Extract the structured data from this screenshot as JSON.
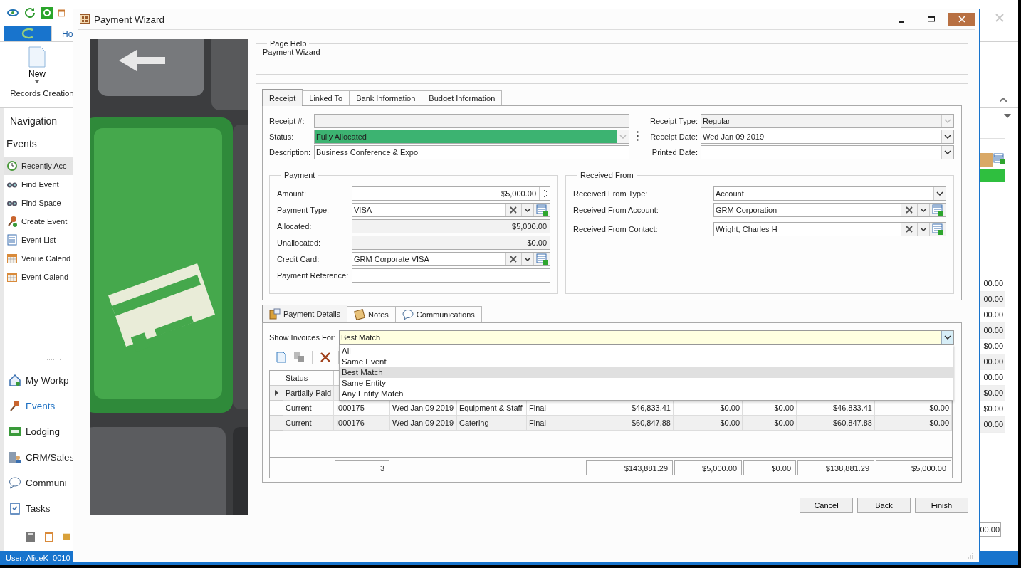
{
  "app": {
    "ribbon_tab": "Ho",
    "new_button": "New",
    "ribbon_group": "Records Creation",
    "nav_title": "Navigation",
    "nav_section": "Events",
    "nav_items": [
      {
        "label": "Recently Acc",
        "selected": true
      },
      {
        "label": "Find Event",
        "selected": false
      },
      {
        "label": "Find Space",
        "selected": false
      },
      {
        "label": "Create Event",
        "selected": false
      },
      {
        "label": "Event List",
        "selected": false
      },
      {
        "label": "Venue Calend",
        "selected": false
      },
      {
        "label": "Event Calend",
        "selected": false
      }
    ],
    "modules": [
      {
        "label": "My Workp",
        "selected": false
      },
      {
        "label": "Events",
        "selected": true
      },
      {
        "label": "Lodging",
        "selected": false
      },
      {
        "label": "CRM/Sales",
        "selected": false
      },
      {
        "label": "Communi",
        "selected": false
      },
      {
        "label": "Tasks",
        "selected": false
      }
    ],
    "status_user": "User: AliceK_0010",
    "behind_cells": [
      "00.00",
      "00.00",
      "00.00",
      "00.00",
      "$0.00",
      "00.00",
      "00.00",
      "$0.00",
      "$0.00",
      "00.00"
    ],
    "behind_total": "00.00"
  },
  "dialog": {
    "title": "Payment Wizard",
    "page_help": {
      "legend": "Page Help",
      "text": "Payment Wizard"
    },
    "tabs": [
      {
        "label": "Receipt",
        "selected": true
      },
      {
        "label": "Linked To",
        "selected": false
      },
      {
        "label": "Bank Information",
        "selected": false
      },
      {
        "label": "Budget Information",
        "selected": false
      }
    ],
    "left_fields": [
      {
        "label": "Receipt #:",
        "kind": "text",
        "disabled": true
      },
      {
        "label": "Status:",
        "kind": "combo",
        "disabled": true,
        "value": "Fully Allocated",
        "color": "#3cb371"
      },
      {
        "label": "Description:",
        "kind": "text",
        "disabled": false,
        "value": "Business Conference & Expo"
      }
    ],
    "right_fields": [
      {
        "label": "Receipt Type:",
        "kind": "combo",
        "disabled": true,
        "value": "Regular"
      },
      {
        "label": "Receipt Date:",
        "kind": "combo",
        "disabled": false,
        "value": "Wed Jan 09 2019"
      },
      {
        "label": "Printed Date:",
        "kind": "combo",
        "disabled": false
      }
    ],
    "payment": {
      "legend": "Payment",
      "fields": [
        {
          "label": "Amount:",
          "kind": "spin",
          "disabled": false,
          "value": "$5,000.00"
        },
        {
          "label": "Payment Type:",
          "kind": "lookup",
          "disabled": false,
          "value": "VISA"
        },
        {
          "label": "Allocated:",
          "kind": "number",
          "disabled": true,
          "value": "$5,000.00"
        },
        {
          "label": "Unallocated:",
          "kind": "number",
          "disabled": true,
          "value": "$0.00"
        },
        {
          "label": "Credit Card:",
          "kind": "lookup",
          "disabled": false,
          "value": "GRM Corporate VISA"
        },
        {
          "label": "Payment Reference:",
          "kind": "text",
          "disabled": false
        }
      ]
    },
    "received": {
      "legend": "Received From",
      "fields": [
        {
          "label": "Received From Type:",
          "kind": "combo",
          "disabled": false,
          "value": "Account"
        },
        {
          "label": "Received From Account:",
          "kind": "lookup",
          "disabled": false,
          "value": "GRM Corporation"
        },
        {
          "label": "Received From Contact:",
          "kind": "lookup",
          "disabled": false,
          "value": "Wright, Charles H"
        }
      ]
    },
    "detail_tabs": [
      {
        "label": "Payment Details",
        "selected": true
      },
      {
        "label": "Notes",
        "selected": false
      },
      {
        "label": "Communications",
        "selected": false
      }
    ],
    "show_invoices": {
      "label": "Show Invoices For:",
      "value": "Best Match",
      "options": [
        {
          "label": "All",
          "selected": false
        },
        {
          "label": "Same Event",
          "selected": false
        },
        {
          "label": "Best Match",
          "selected": true
        },
        {
          "label": "Same Entity",
          "selected": false
        },
        {
          "label": "Any Entity Match",
          "selected": false
        }
      ]
    },
    "grid": {
      "columns": [
        "Status"
      ],
      "rows": [
        {
          "focused": true,
          "cells": [
            "Partially Paid"
          ]
        },
        {
          "focused": false,
          "cells": [
            "Current",
            "I000175",
            "Wed Jan 09 2019",
            "Equipment & Staff",
            "Final",
            "$46,833.41",
            "$0.00",
            "$0.00",
            "$46,833.41",
            "$0.00"
          ]
        },
        {
          "focused": false,
          "cells": [
            "Current",
            "I000176",
            "Wed Jan 09 2019",
            "Catering",
            "Final",
            "$60,847.88",
            "$0.00",
            "$0.00",
            "$60,847.88",
            "$0.00"
          ]
        }
      ],
      "footer_count": "3",
      "footer_totals": [
        "$143,881.29",
        "$5,000.00",
        "$0.00",
        "$138,881.29",
        "$5,000.00"
      ]
    },
    "buttons": [
      "Cancel",
      "Back",
      "Finish"
    ]
  }
}
